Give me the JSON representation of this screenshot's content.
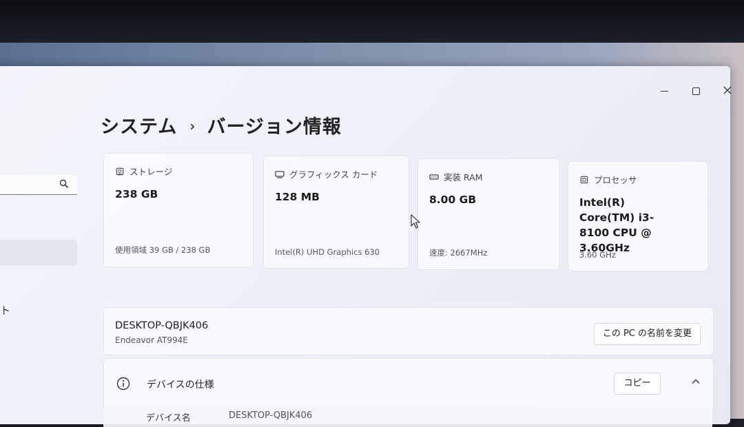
{
  "window": {
    "controls": {
      "minimize": "—",
      "maximize": "□",
      "close": "✕"
    }
  },
  "sidebar": {
    "search": {
      "value": "",
      "icon": "search-icon"
    },
    "fragment_text": "ト"
  },
  "breadcrumb": {
    "parent": "システム",
    "separator": "›",
    "current": "バージョン情報"
  },
  "spec_cards": [
    {
      "label": "ストレージ",
      "icon": "storage-icon",
      "value": "238 GB",
      "detail": "使用領域 39 GB / 238 GB"
    },
    {
      "label": "グラフィックス カード",
      "icon": "graphics-card-icon",
      "value": "128 MB",
      "detail": "Intel(R) UHD Graphics 630"
    },
    {
      "label": "実装 RAM",
      "icon": "ram-icon",
      "value": "8.00 GB",
      "detail": "速度: 2667MHz"
    },
    {
      "label": "プロセッサ",
      "icon": "processor-icon",
      "value": "Intel(R) Core(TM) i3-8100 CPU @ 3.60GHz",
      "detail": "3.60 GHz"
    }
  ],
  "device": {
    "name": "DESKTOP-QBJK406",
    "model": "Endeavor AT994E",
    "rename_label": "この PC の名前を変更"
  },
  "device_specs": {
    "title": "デバイスの仕様",
    "copy_label": "コピー",
    "first_row": {
      "label": "デバイス名",
      "value": "DESKTOP-QBJK406"
    }
  }
}
